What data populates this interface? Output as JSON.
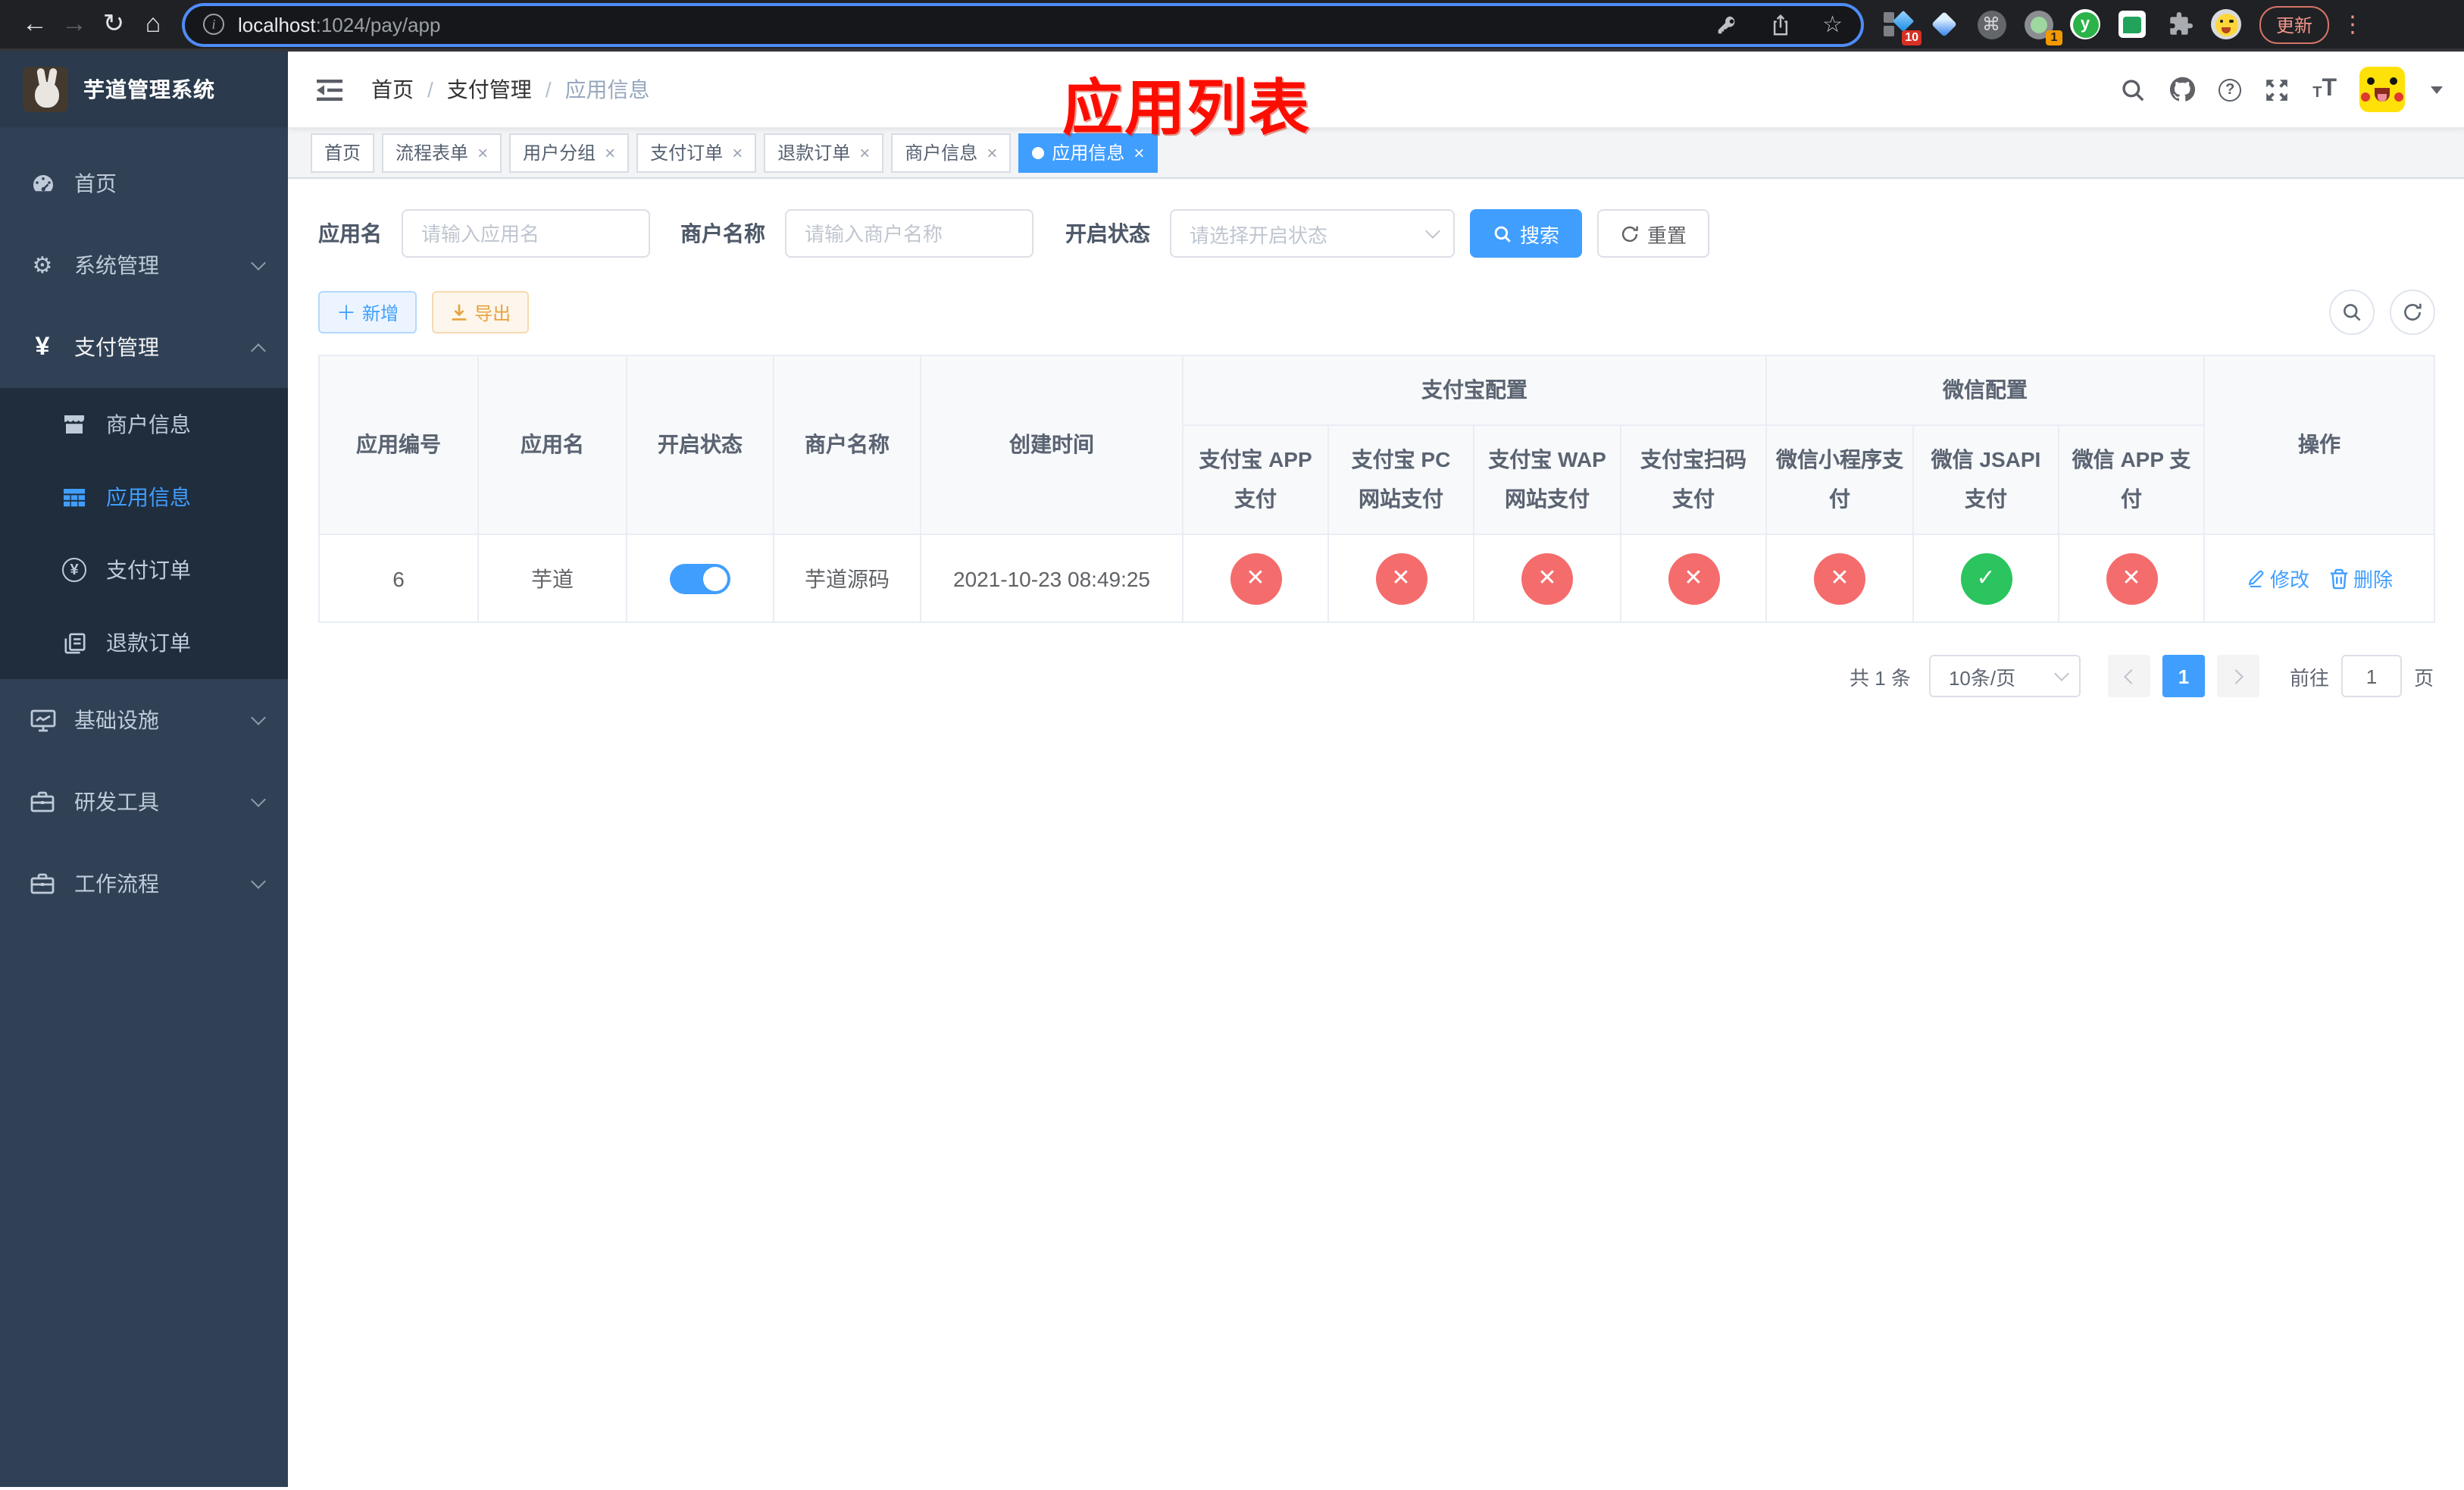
{
  "colors": {
    "accent": "#409eff",
    "danger": "#f56c6c",
    "success": "#2bc45f",
    "sidebar_bg": "#304156",
    "submenu_bg": "#1f2d3d",
    "tag_active": "#409eff"
  },
  "icons": {
    "close": "×",
    "dot": "●",
    "plus": "＋",
    "yen": "¥",
    "check": "✓",
    "cross": "✕",
    "back": "←",
    "forward": "→",
    "reload": "↻",
    "home": "⌂",
    "star": "☆",
    "info": "i",
    "question": "?",
    "gear": "⚙",
    "command": "⌘",
    "kebab": "⋮",
    "slash": "/",
    "tt_small": "T",
    "tt_big": "T"
  },
  "browser": {
    "url_host": "localhost",
    "url_rest": ":1024/pay/app",
    "update_label": "更新",
    "ext_y_label": "y",
    "badges": {
      "pin": "10",
      "proxy": "1"
    }
  },
  "annotation": "应用列表",
  "sidebar": {
    "title": "芋道管理系统",
    "items": [
      {
        "label": "首页"
      },
      {
        "label": "系统管理"
      },
      {
        "label": "支付管理"
      },
      {
        "label": "基础设施"
      },
      {
        "label": "研发工具"
      },
      {
        "label": "工作流程"
      }
    ],
    "payment_children": [
      {
        "label": "商户信息"
      },
      {
        "label": "应用信息",
        "selected": true
      },
      {
        "label": "支付订单"
      },
      {
        "label": "退款订单"
      }
    ]
  },
  "navbar": {
    "breadcrumb": [
      "首页",
      "支付管理",
      "应用信息"
    ]
  },
  "tabs": [
    {
      "label": "首页",
      "closable": false,
      "active": false
    },
    {
      "label": "流程表单",
      "closable": true,
      "active": false
    },
    {
      "label": "用户分组",
      "closable": true,
      "active": false
    },
    {
      "label": "支付订单",
      "closable": true,
      "active": false
    },
    {
      "label": "退款订单",
      "closable": true,
      "active": false
    },
    {
      "label": "商户信息",
      "closable": true,
      "active": false
    },
    {
      "label": "应用信息",
      "closable": true,
      "active": true
    }
  ],
  "filters": {
    "app_name_label": "应用名",
    "app_name_placeholder": "请输入应用名",
    "merchant_label": "商户名称",
    "merchant_placeholder": "请输入商户名称",
    "status_label": "开启状态",
    "status_placeholder": "请选择开启状态",
    "search_label": "搜索",
    "reset_label": "重置"
  },
  "toolbar": {
    "add_label": "新增",
    "export_label": "导出"
  },
  "table": {
    "header": {
      "simple": [
        "应用编号",
        "应用名",
        "开启状态",
        "商户名称",
        "创建时间"
      ],
      "groups": [
        {
          "label": "支付宝配置",
          "children": [
            "支付宝 APP 支付",
            "支付宝 PC 网站支付",
            "支付宝 WAP 网站支付",
            "支付宝扫码支付"
          ]
        },
        {
          "label": "微信配置",
          "children": [
            "微信小程序支付",
            "微信 JSAPI 支付",
            "微信 APP 支付"
          ]
        }
      ],
      "ops": "操作"
    },
    "row": {
      "id": "6",
      "name": "芋道",
      "enabled": true,
      "merchant": "芋道源码",
      "created": "2021-10-23 08:49:25",
      "statuses": [
        "disabled",
        "disabled",
        "disabled",
        "disabled",
        "disabled",
        "enabled",
        "disabled"
      ],
      "ops": [
        "修改",
        "删除"
      ]
    }
  },
  "pagination": {
    "total_label": "共 1 条",
    "page_size_label": "10条/页",
    "current_page": "1",
    "goto_label": "前往",
    "goto_value": "1",
    "unit_label": "页"
  }
}
